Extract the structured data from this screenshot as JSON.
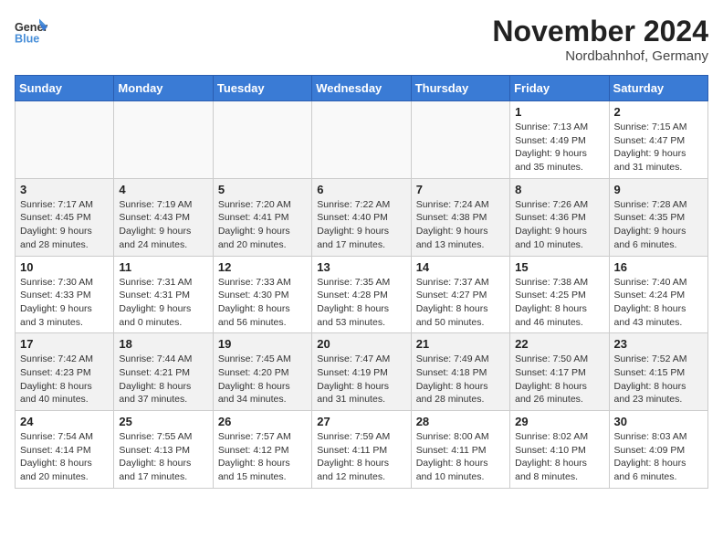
{
  "header": {
    "logo_text_general": "General",
    "logo_text_blue": "Blue",
    "month_title": "November 2024",
    "location": "Nordbahnhof, Germany"
  },
  "weekdays": [
    "Sunday",
    "Monday",
    "Tuesday",
    "Wednesday",
    "Thursday",
    "Friday",
    "Saturday"
  ],
  "weeks": [
    [
      {
        "day": "",
        "sunrise": "",
        "sunset": "",
        "daylight": ""
      },
      {
        "day": "",
        "sunrise": "",
        "sunset": "",
        "daylight": ""
      },
      {
        "day": "",
        "sunrise": "",
        "sunset": "",
        "daylight": ""
      },
      {
        "day": "",
        "sunrise": "",
        "sunset": "",
        "daylight": ""
      },
      {
        "day": "",
        "sunrise": "",
        "sunset": "",
        "daylight": ""
      },
      {
        "day": "1",
        "sunrise": "Sunrise: 7:13 AM",
        "sunset": "Sunset: 4:49 PM",
        "daylight": "Daylight: 9 hours and 35 minutes."
      },
      {
        "day": "2",
        "sunrise": "Sunrise: 7:15 AM",
        "sunset": "Sunset: 4:47 PM",
        "daylight": "Daylight: 9 hours and 31 minutes."
      }
    ],
    [
      {
        "day": "3",
        "sunrise": "Sunrise: 7:17 AM",
        "sunset": "Sunset: 4:45 PM",
        "daylight": "Daylight: 9 hours and 28 minutes."
      },
      {
        "day": "4",
        "sunrise": "Sunrise: 7:19 AM",
        "sunset": "Sunset: 4:43 PM",
        "daylight": "Daylight: 9 hours and 24 minutes."
      },
      {
        "day": "5",
        "sunrise": "Sunrise: 7:20 AM",
        "sunset": "Sunset: 4:41 PM",
        "daylight": "Daylight: 9 hours and 20 minutes."
      },
      {
        "day": "6",
        "sunrise": "Sunrise: 7:22 AM",
        "sunset": "Sunset: 4:40 PM",
        "daylight": "Daylight: 9 hours and 17 minutes."
      },
      {
        "day": "7",
        "sunrise": "Sunrise: 7:24 AM",
        "sunset": "Sunset: 4:38 PM",
        "daylight": "Daylight: 9 hours and 13 minutes."
      },
      {
        "day": "8",
        "sunrise": "Sunrise: 7:26 AM",
        "sunset": "Sunset: 4:36 PM",
        "daylight": "Daylight: 9 hours and 10 minutes."
      },
      {
        "day": "9",
        "sunrise": "Sunrise: 7:28 AM",
        "sunset": "Sunset: 4:35 PM",
        "daylight": "Daylight: 9 hours and 6 minutes."
      }
    ],
    [
      {
        "day": "10",
        "sunrise": "Sunrise: 7:30 AM",
        "sunset": "Sunset: 4:33 PM",
        "daylight": "Daylight: 9 hours and 3 minutes."
      },
      {
        "day": "11",
        "sunrise": "Sunrise: 7:31 AM",
        "sunset": "Sunset: 4:31 PM",
        "daylight": "Daylight: 9 hours and 0 minutes."
      },
      {
        "day": "12",
        "sunrise": "Sunrise: 7:33 AM",
        "sunset": "Sunset: 4:30 PM",
        "daylight": "Daylight: 8 hours and 56 minutes."
      },
      {
        "day": "13",
        "sunrise": "Sunrise: 7:35 AM",
        "sunset": "Sunset: 4:28 PM",
        "daylight": "Daylight: 8 hours and 53 minutes."
      },
      {
        "day": "14",
        "sunrise": "Sunrise: 7:37 AM",
        "sunset": "Sunset: 4:27 PM",
        "daylight": "Daylight: 8 hours and 50 minutes."
      },
      {
        "day": "15",
        "sunrise": "Sunrise: 7:38 AM",
        "sunset": "Sunset: 4:25 PM",
        "daylight": "Daylight: 8 hours and 46 minutes."
      },
      {
        "day": "16",
        "sunrise": "Sunrise: 7:40 AM",
        "sunset": "Sunset: 4:24 PM",
        "daylight": "Daylight: 8 hours and 43 minutes."
      }
    ],
    [
      {
        "day": "17",
        "sunrise": "Sunrise: 7:42 AM",
        "sunset": "Sunset: 4:23 PM",
        "daylight": "Daylight: 8 hours and 40 minutes."
      },
      {
        "day": "18",
        "sunrise": "Sunrise: 7:44 AM",
        "sunset": "Sunset: 4:21 PM",
        "daylight": "Daylight: 8 hours and 37 minutes."
      },
      {
        "day": "19",
        "sunrise": "Sunrise: 7:45 AM",
        "sunset": "Sunset: 4:20 PM",
        "daylight": "Daylight: 8 hours and 34 minutes."
      },
      {
        "day": "20",
        "sunrise": "Sunrise: 7:47 AM",
        "sunset": "Sunset: 4:19 PM",
        "daylight": "Daylight: 8 hours and 31 minutes."
      },
      {
        "day": "21",
        "sunrise": "Sunrise: 7:49 AM",
        "sunset": "Sunset: 4:18 PM",
        "daylight": "Daylight: 8 hours and 28 minutes."
      },
      {
        "day": "22",
        "sunrise": "Sunrise: 7:50 AM",
        "sunset": "Sunset: 4:17 PM",
        "daylight": "Daylight: 8 hours and 26 minutes."
      },
      {
        "day": "23",
        "sunrise": "Sunrise: 7:52 AM",
        "sunset": "Sunset: 4:15 PM",
        "daylight": "Daylight: 8 hours and 23 minutes."
      }
    ],
    [
      {
        "day": "24",
        "sunrise": "Sunrise: 7:54 AM",
        "sunset": "Sunset: 4:14 PM",
        "daylight": "Daylight: 8 hours and 20 minutes."
      },
      {
        "day": "25",
        "sunrise": "Sunrise: 7:55 AM",
        "sunset": "Sunset: 4:13 PM",
        "daylight": "Daylight: 8 hours and 17 minutes."
      },
      {
        "day": "26",
        "sunrise": "Sunrise: 7:57 AM",
        "sunset": "Sunset: 4:12 PM",
        "daylight": "Daylight: 8 hours and 15 minutes."
      },
      {
        "day": "27",
        "sunrise": "Sunrise: 7:59 AM",
        "sunset": "Sunset: 4:11 PM",
        "daylight": "Daylight: 8 hours and 12 minutes."
      },
      {
        "day": "28",
        "sunrise": "Sunrise: 8:00 AM",
        "sunset": "Sunset: 4:11 PM",
        "daylight": "Daylight: 8 hours and 10 minutes."
      },
      {
        "day": "29",
        "sunrise": "Sunrise: 8:02 AM",
        "sunset": "Sunset: 4:10 PM",
        "daylight": "Daylight: 8 hours and 8 minutes."
      },
      {
        "day": "30",
        "sunrise": "Sunrise: 8:03 AM",
        "sunset": "Sunset: 4:09 PM",
        "daylight": "Daylight: 8 hours and 6 minutes."
      }
    ]
  ]
}
